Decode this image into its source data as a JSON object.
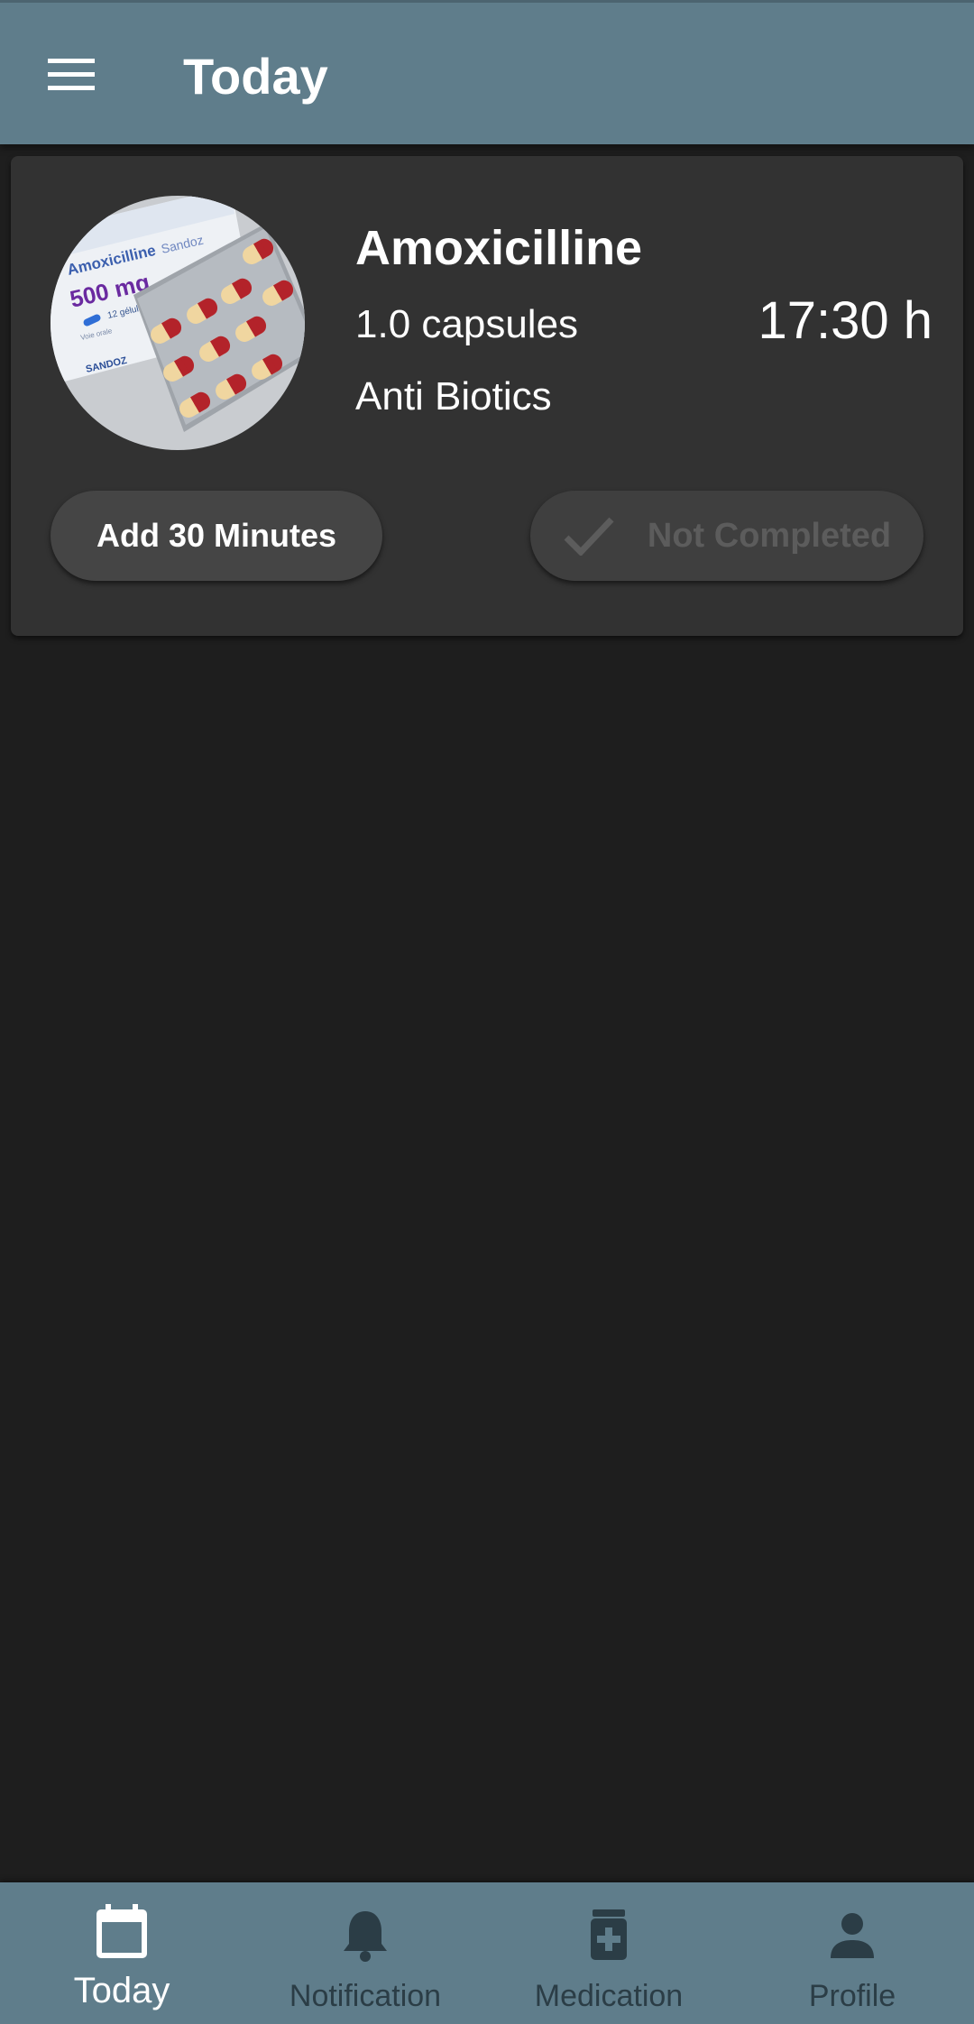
{
  "app_bar": {
    "title": "Today",
    "menu_icon": "hamburger-menu-icon"
  },
  "medication_card": {
    "photo_icon": "medication-photo",
    "name": "Amoxicilline",
    "dose": "1.0 capsules",
    "time": "17:30 h",
    "category": "Anti Biotics",
    "add_button_label": "Add 30 Minutes",
    "status_button_label": "Not Completed",
    "status_icon": "check-icon",
    "photo_lettering": {
      "brand": "Amoxicilline",
      "maker": "Sandoz",
      "strength": "500 mg",
      "count": "12 gélules",
      "small": "Voie orale",
      "logo": "SANDOZ"
    }
  },
  "bottom_nav": {
    "items": [
      {
        "label": "Today",
        "icon": "calendar-icon",
        "active": true
      },
      {
        "label": "Notification",
        "icon": "bell-icon",
        "active": false
      },
      {
        "label": "Medication",
        "icon": "medicine-bottle-icon",
        "active": false
      },
      {
        "label": "Profile",
        "icon": "person-icon",
        "active": false
      }
    ]
  },
  "colors": {
    "app_bar": "#5f7d8b",
    "background": "#1e1e1e",
    "card": "#323232",
    "nav_label_inactive": "#2b3d46",
    "nav_label_active": "#ffffff"
  }
}
